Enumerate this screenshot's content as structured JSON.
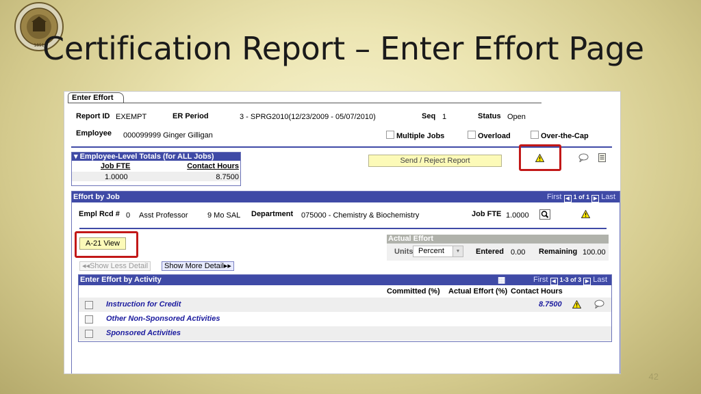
{
  "slide": {
    "title": "Certification Report – Enter Effort Page",
    "page_number": "42",
    "seal_text_top": "FLORIDA STATE UNIVERSITY",
    "seal_year": "1851"
  },
  "tab": {
    "label": "Enter Effort"
  },
  "report": {
    "report_id_label": "Report ID",
    "report_id": "EXEMPT",
    "er_period_label": "ER Period",
    "er_period": "3 - SPRG2010(12/23/2009 - 05/07/2010)",
    "seq_label": "Seq",
    "seq": "1",
    "status_label": "Status",
    "status": "Open",
    "employee_label": "Employee",
    "employee": "000099999 Ginger Gilligan",
    "multiple_jobs": "Multiple Jobs",
    "overload": "Overload",
    "over_the_cap": "Over-the-Cap"
  },
  "employee_totals": {
    "title": "Employee-Level Totals (for ALL Jobs)",
    "col_job_fte": "Job FTE",
    "col_contact_hours": "Contact Hours",
    "job_fte": "1.0000",
    "contact_hours": "8.7500"
  },
  "send_reject": {
    "label": "Send / Reject Report"
  },
  "effort_by_job": {
    "title": "Effort by Job",
    "nav_first": "First",
    "nav_count": "1 of 1",
    "nav_last": "Last",
    "empl_rcd_label": "Empl Rcd #",
    "empl_rcd": "0",
    "job_title": "Asst Professor",
    "salary": "9 Mo SAL",
    "department_label": "Department",
    "department": "075000 - Chemistry & Biochemistry",
    "job_fte_label": "Job FTE",
    "job_fte": "1.0000"
  },
  "a21": {
    "label": "A-21 View"
  },
  "actual_effort": {
    "title": "Actual Effort",
    "units_label": "Units",
    "units_value": "Percent",
    "entered_label": "Entered",
    "entered": "0.00",
    "remaining_label": "Remaining",
    "remaining": "100.00"
  },
  "detail": {
    "show_less": "Show Less Detail",
    "show_more": "Show More Detail"
  },
  "activity": {
    "title": "Enter Effort by Activity",
    "nav_first": "First",
    "nav_count": "1-3 of 3",
    "nav_last": "Last",
    "col_committed": "Committed (%)",
    "col_actual": "Actual Effort (%)",
    "col_contact": "Contact Hours",
    "rows": [
      {
        "name": "Instruction for Credit",
        "contact_hours": "8.7500"
      },
      {
        "name": "Other Non-Sponsored Activities",
        "contact_hours": ""
      },
      {
        "name": "Sponsored Activities",
        "contact_hours": ""
      }
    ]
  },
  "colors": {
    "header_blue": "#3f4aa6",
    "highlight_red": "#c21818",
    "button_yellow": "#fcfab8",
    "link_blue": "#1a1a9e"
  }
}
